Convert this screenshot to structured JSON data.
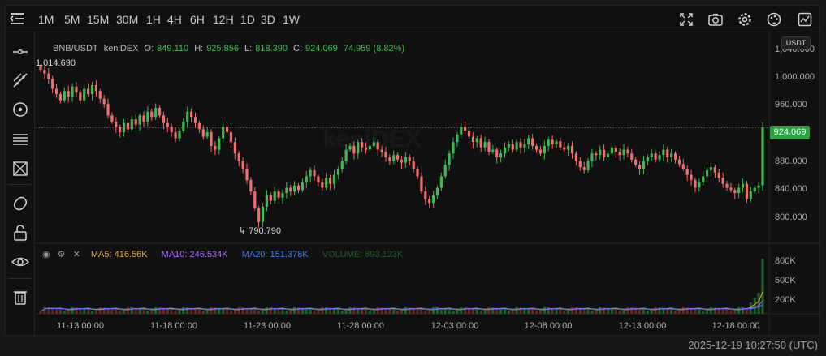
{
  "timeframes": [
    "1M",
    "5M",
    "15M",
    "30M",
    "1H",
    "4H",
    "6H",
    "12H",
    "1D",
    "3D",
    "1W"
  ],
  "toolbar_icons": [
    "fullscreen-icon",
    "camera-icon",
    "settings-icon",
    "palette-icon",
    "chart-type-icon"
  ],
  "sidebar_icons": [
    "crosshair-line-icon",
    "trend-line-icon",
    "circle-target-icon",
    "horizontal-lines-icon",
    "fib-tool-icon",
    "magnet-icon",
    "unlock-icon",
    "eye-icon",
    "trash-icon"
  ],
  "legend": {
    "pair": "BNB/USDT",
    "exchange": "keniDEX",
    "o_label": "O:",
    "o": "849.110",
    "h_label": "H:",
    "h": "925.856",
    "l_label": "L:",
    "l": "818.390",
    "c_label": "C:",
    "c": "924.069",
    "change": "74.959 (8.82%)"
  },
  "quote_currency": "USDT",
  "last_price": "924.069",
  "price_axis": [
    "1,040.000",
    "1,000.000",
    "960.000",
    "920.000",
    "880.000",
    "840.000",
    "800.000"
  ],
  "high_marker": "1,014.690",
  "low_marker": "790.790",
  "volume_legend": {
    "ma5": "MA5: 416.56K",
    "ma10": "MA10: 246.534K",
    "ma20": "MA20: 151.378K",
    "volume": "VOLUME: 893.123K"
  },
  "volume_axis": [
    "800K",
    "500K",
    "200K"
  ],
  "time_axis": [
    "11-13 00:00",
    "11-18 00:00",
    "11-23 00:00",
    "11-28 00:00",
    "12-03 00:00",
    "12-08 00:00",
    "12-13 00:00",
    "12-18 00:00"
  ],
  "footer_time": "2025-12-19 10:27:50 (UTC)",
  "watermark": "keniDEX",
  "colors": {
    "up": "#3fb950",
    "down": "#f26d6d",
    "ma5": "#e8a53a",
    "ma10": "#a86cf0",
    "ma20": "#3d7ff0",
    "volume": "#2f8a3c"
  },
  "chart_data": {
    "type": "candlestick",
    "price_range": [
      772,
      1048
    ],
    "closes": [
      1000,
      995,
      988,
      975,
      968,
      960,
      972,
      965,
      978,
      970,
      960,
      975,
      968,
      980,
      972,
      962,
      955,
      940,
      932,
      925,
      918,
      930,
      922,
      935,
      928,
      940,
      932,
      945,
      938,
      950,
      940,
      930,
      925,
      918,
      910,
      920,
      932,
      945,
      938,
      930,
      922,
      912,
      918,
      900,
      895,
      910,
      925,
      918,
      905,
      890,
      880,
      870,
      855,
      840,
      818,
      800,
      820,
      835,
      828,
      840,
      832,
      838,
      845,
      840,
      848,
      842,
      852,
      860,
      868,
      860,
      852,
      845,
      858,
      850,
      862,
      870,
      880,
      895,
      900,
      890,
      905,
      898,
      895,
      900,
      905,
      895,
      892,
      885,
      880,
      888,
      882,
      878,
      885,
      880,
      870,
      860,
      840,
      830,
      825,
      835,
      845,
      860,
      875,
      890,
      905,
      915,
      925,
      920,
      912,
      905,
      910,
      898,
      905,
      892,
      895,
      885,
      890,
      898,
      902,
      895,
      905,
      898,
      902,
      910,
      900,
      895,
      890,
      900,
      908,
      902,
      906,
      898,
      895,
      900,
      890,
      880,
      872,
      868,
      880,
      890,
      888,
      895,
      885,
      890,
      898,
      892,
      888,
      895,
      890,
      882,
      875,
      870,
      880,
      885,
      890,
      882,
      888,
      895,
      885,
      890,
      882,
      876,
      870,
      862,
      855,
      845,
      852,
      860,
      868,
      872,
      865,
      858,
      850,
      845,
      842,
      838,
      845,
      850,
      830,
      840,
      845,
      848,
      924
    ]
  }
}
